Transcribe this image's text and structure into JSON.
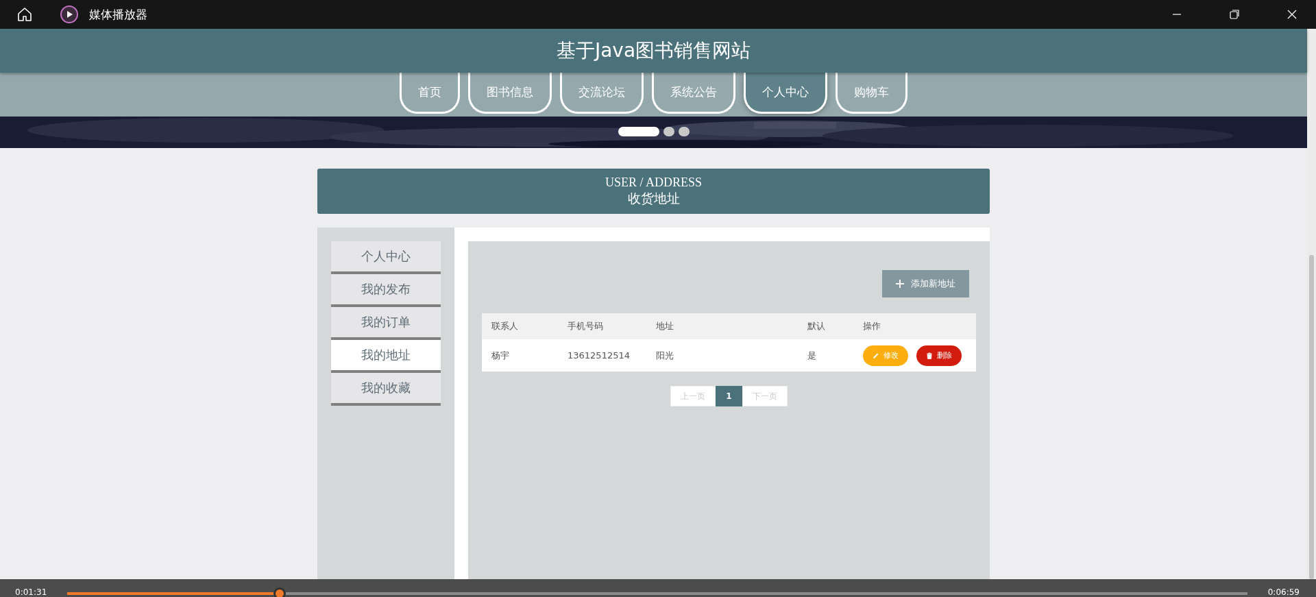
{
  "player": {
    "title": "媒体播放器",
    "elapsed": "0:01:31",
    "duration": "0:06:59",
    "progress": {
      "level": 0.18
    }
  },
  "site": {
    "title": "基于Java图书销售网站",
    "nav": [
      {
        "label": "首页",
        "selected": false
      },
      {
        "label": "图书信息",
        "selected": false
      },
      {
        "label": "交流论坛",
        "selected": false
      },
      {
        "label": "系统公告",
        "selected": false
      },
      {
        "label": "个人中心",
        "selected": true
      },
      {
        "label": "购物车",
        "selected": false
      }
    ],
    "carousel_dots": [
      {
        "selected": true
      },
      {
        "selected": false
      },
      {
        "selected": false
      }
    ]
  },
  "section": {
    "title_en": "USER / ADDRESS",
    "title": "收货地址"
  },
  "sidebar": {
    "items": [
      {
        "label": "个人中心",
        "selected": false
      },
      {
        "label": "我的发布",
        "selected": false
      },
      {
        "label": "我的订单",
        "selected": false
      },
      {
        "label": "我的地址",
        "selected": true
      },
      {
        "label": "我的收藏",
        "selected": false
      }
    ]
  },
  "add_button": "添加新地址",
  "table": {
    "columns": [
      "联系人",
      "手机号码",
      "地址",
      "默认",
      "操作"
    ],
    "rows": [
      {
        "cells": [
          "杨宇",
          "13612512514",
          "阳光",
          "是"
        ],
        "actions": [
          {
            "kind": "edit",
            "label": "修改"
          },
          {
            "kind": "delete",
            "label": "删除"
          }
        ]
      }
    ]
  },
  "pagination": {
    "prev": "上一页",
    "pages": [
      {
        "label": "1",
        "selected": true
      }
    ],
    "next": "下一页"
  }
}
